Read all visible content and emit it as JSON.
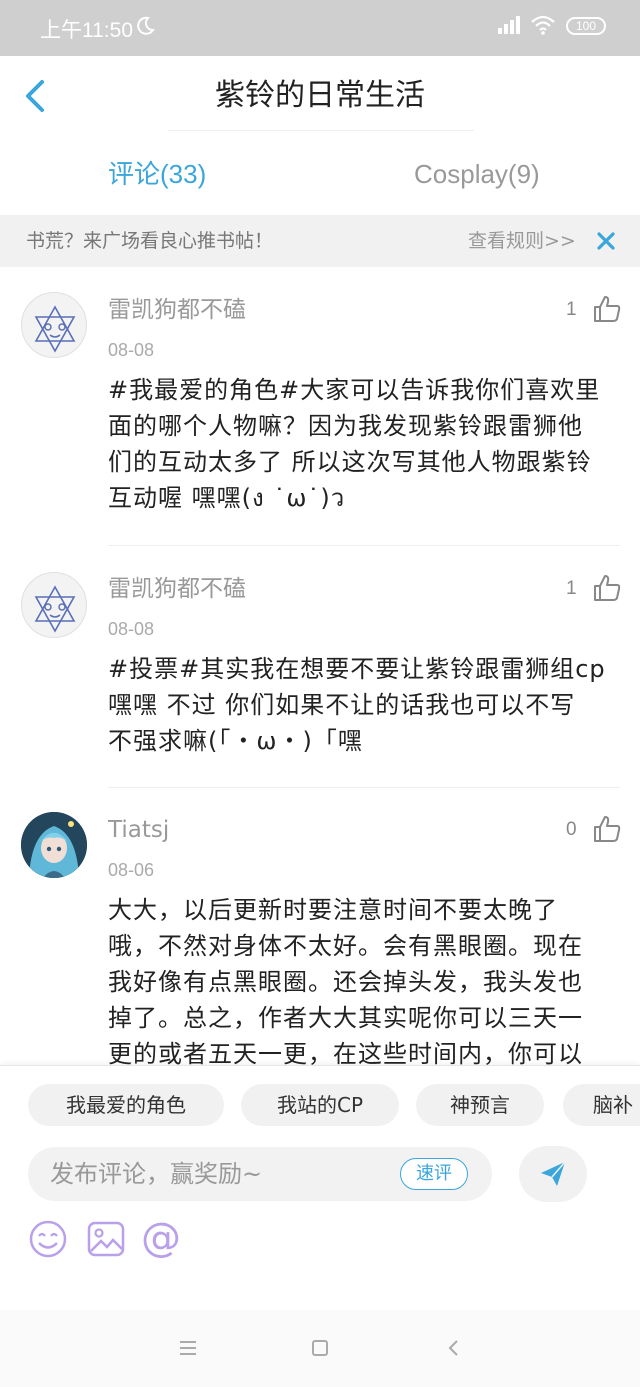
{
  "status_bar": {
    "time": "上午11:50",
    "battery": "100",
    "icons": [
      "moon-icon",
      "signal-icon",
      "wifi-icon",
      "battery-icon"
    ]
  },
  "header": {
    "title": "紫铃的日常生活",
    "back_icon": "chevron-left-icon"
  },
  "tabs": [
    {
      "label": "评论(33)",
      "active": true
    },
    {
      "label": "Cosplay(9)",
      "active": false
    }
  ],
  "notice": {
    "text": "书荒？来广场看良心推书帖！",
    "link": "查看规则>>",
    "close_icon": "close-icon"
  },
  "comments": [
    {
      "username": "雷凯狗都不磕",
      "date": "08-08",
      "likes": "1",
      "lines": [
        "#我最爱的角色#大家可以告诉我你们喜欢里",
        "面的哪个人物嘛？因为我发现紫铃跟雷狮他",
        "们的互动太多了 所以这次写其他人物跟紫铃",
        "互动喔 嘿嘿(ง ˙ω˙)ว"
      ]
    },
    {
      "username": "雷凯狗都不磕",
      "date": "08-08",
      "likes": "1",
      "lines": [
        "#投票#其实我在想要不要让紫铃跟雷狮组cp",
        "嘿嘿 不过 你们如果不让的话我也可以不写",
        "不强求嘛(「・ω・)「嘿"
      ]
    },
    {
      "username": "Tiatsj",
      "date": "08-06",
      "likes": "0",
      "lines": [
        "大大，以后更新时要注意时间不要太晚了",
        "哦，不然对身体不太好。会有黑眼圈。现在",
        "我好像有点黑眼圈。还会掉头发，我头发也",
        "掉了。总之，作者大大其实呢你可以三天一",
        "更的或者五天一更，在这些时间内，你可以"
      ]
    }
  ],
  "topic_chips": [
    "我最爱的角色",
    "我站的CP",
    "神预言",
    "脑补"
  ],
  "composer": {
    "placeholder": "发布评论，赢奖励~",
    "quick_button": "速评",
    "send_icon": "send-icon",
    "tools": [
      "emoji-icon",
      "image-icon",
      "at-icon"
    ]
  },
  "colors": {
    "accent": "#3aa6db",
    "tool_purple": "#b9a0ea",
    "status_bar": "#cfcfcf"
  },
  "nav_icons": [
    "menu-icon",
    "home-icon",
    "back-icon"
  ]
}
